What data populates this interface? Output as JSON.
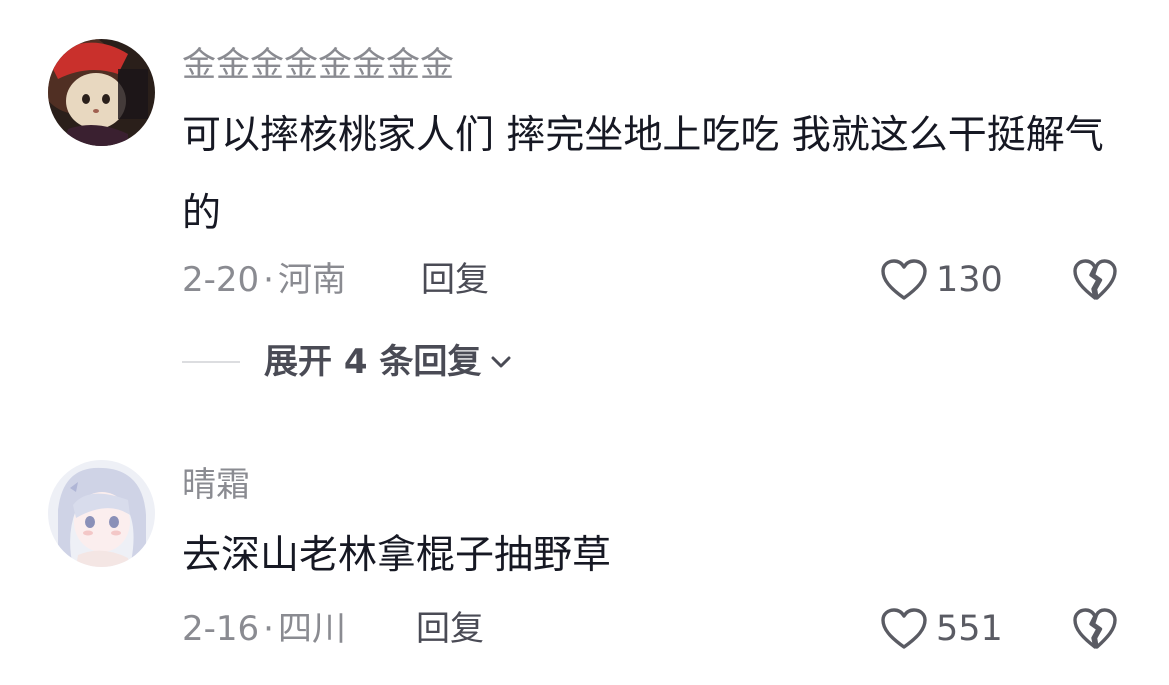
{
  "comments": [
    {
      "username": "金金金金金金金金",
      "text": "可以摔核桃家人们 摔完坐地上吃吃 我就这么干挺解气的",
      "date": "2-20",
      "dot": "·",
      "location": "河南",
      "reply_label": "回复",
      "likes": "130",
      "avatar": "cat-avatar",
      "expand_label": "展开 4 条回复"
    },
    {
      "username": "晴霜",
      "text": "去深山老林拿棍子抽野草",
      "date": "2-16",
      "dot": "·",
      "location": "四川",
      "reply_label": "回复",
      "likes": "551",
      "avatar": "anime-girl-avatar"
    }
  ],
  "icons": {
    "like": "heart-outline-icon",
    "dislike": "broken-heart-icon",
    "expand": "chevron-down-icon"
  }
}
